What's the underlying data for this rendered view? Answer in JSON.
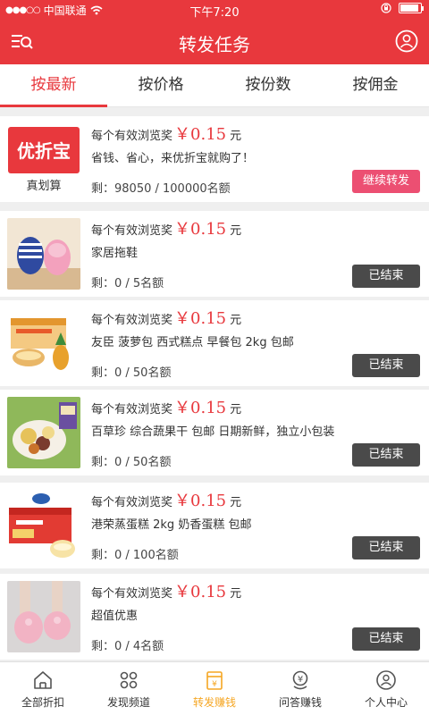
{
  "status_bar": {
    "carrier": "中国联通",
    "time": "下午7:20"
  },
  "header": {
    "title": "转发任务"
  },
  "tabs": [
    {
      "label": "按最新",
      "active": true
    },
    {
      "label": "按价格",
      "active": false
    },
    {
      "label": "按份数",
      "active": false
    },
    {
      "label": "按佣金",
      "active": false
    }
  ],
  "tasks": [
    {
      "reward_prefix": "每个有效浏览奖",
      "price": "￥0.15",
      "unit": "元",
      "description": "省钱、省心，来优折宝就购了！",
      "remaining": "剩：98050 / 100000名额",
      "button": "继续转发",
      "status": "active",
      "thumb": "youzhebao-logo",
      "thumb_logo_text": "优折宝",
      "thumb_caption": "真划算"
    },
    {
      "reward_prefix": "每个有效浏览奖",
      "price": "￥0.15",
      "unit": "元",
      "description": "家居拖鞋",
      "remaining": "剩：0 / 5名额",
      "button": "已结束",
      "status": "ended",
      "thumb": "slippers-photo"
    },
    {
      "reward_prefix": "每个有效浏览奖",
      "price": "￥0.15",
      "unit": "元",
      "description": "友臣 菠萝包 西式糕点 早餐包 2kg 包邮",
      "remaining": "剩：0 / 50名额",
      "button": "已结束",
      "status": "ended",
      "thumb": "pineapple-bread-photo"
    },
    {
      "reward_prefix": "每个有效浏览奖",
      "price": "￥0.15",
      "unit": "元",
      "description": "百草珍 综合蔬果干 包邮 日期新鲜，独立小包装",
      "remaining": "剩：0 / 50名额",
      "button": "已结束",
      "status": "ended",
      "thumb": "dried-fruit-photo"
    },
    {
      "reward_prefix": "每个有效浏览奖",
      "price": "￥0.15",
      "unit": "元",
      "description": "港荣蒸蛋糕 2kg 奶香蛋糕 包邮",
      "remaining": "剩：0 / 100名额",
      "button": "已结束",
      "status": "ended",
      "thumb": "steamed-cake-photo"
    },
    {
      "reward_prefix": "每个有效浏览奖",
      "price": "￥0.15",
      "unit": "元",
      "description": "超值优惠",
      "remaining": "剩：0 / 4名额",
      "button": "已结束",
      "status": "ended",
      "thumb": "pink-slippers-photo"
    }
  ],
  "bottom_nav": [
    {
      "label": "全部折扣",
      "icon": "home-icon",
      "active": false
    },
    {
      "label": "发现频道",
      "icon": "discover-icon",
      "active": false
    },
    {
      "label": "转发赚钱",
      "icon": "share-earn-icon",
      "active": true
    },
    {
      "label": "问答赚钱",
      "icon": "qa-icon",
      "active": false
    },
    {
      "label": "个人中心",
      "icon": "profile-icon",
      "active": false
    }
  ],
  "colors": {
    "brand": "#e8383d",
    "price": "#e8383d",
    "active_button": "#ec4f72",
    "ended_button": "#4a4a4a",
    "active_nav": "#f5a623"
  }
}
